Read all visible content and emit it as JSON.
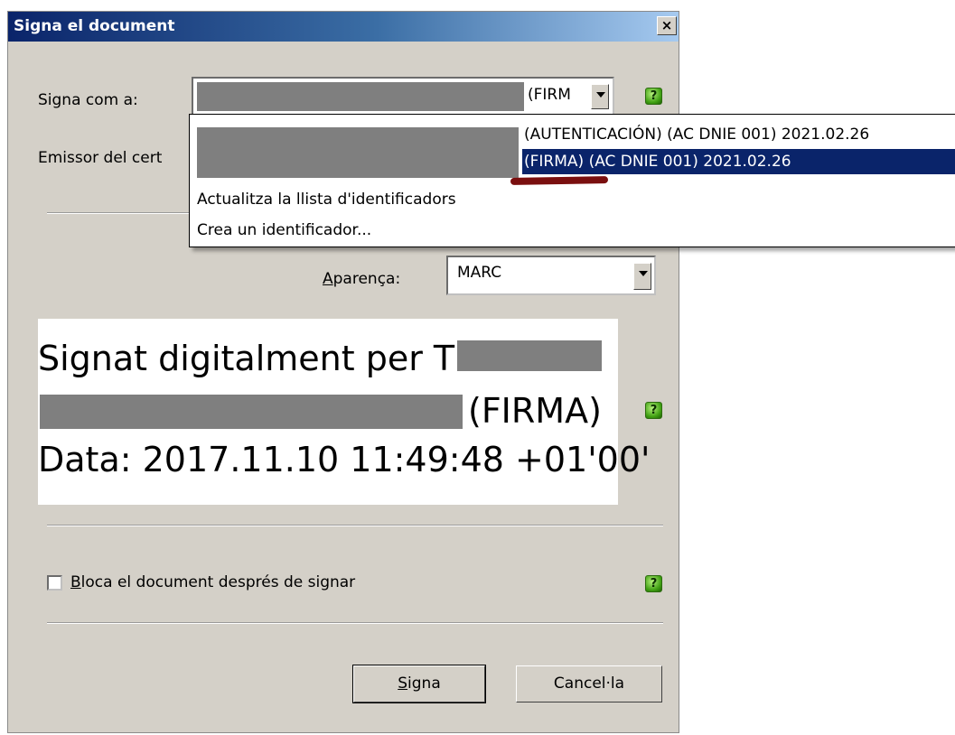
{
  "dialog": {
    "title": "Signa el document",
    "close_glyph": "×"
  },
  "sign_as": {
    "label": "Signa com a:",
    "combo_text": "(FIRM"
  },
  "issuer": {
    "label": "Emissor del cert"
  },
  "appearance": {
    "label_underline": "A",
    "label_rest": "parença:",
    "value": "MARC"
  },
  "preview": {
    "line1": "Signat digitalment per T",
    "line2": "(FIRMA)",
    "line3": "Data: 2017.11.10 11:49:48 +01'00'"
  },
  "lock": {
    "label_underline": "B",
    "label_rest": "loca el document després de signar"
  },
  "buttons": {
    "sign_underline": "S",
    "sign_rest": "igna",
    "cancel": "Cancel·la"
  },
  "dropdown": {
    "options": [
      "(AUTENTICACIÓN) (AC DNIE 001) 2021.02.26",
      "(FIRMA) (AC DNIE 001) 2021.02.26",
      "Actualitza la llista d'identificadors",
      "Crea un identificador..."
    ],
    "selected_index": 1
  },
  "icons": {
    "help": "?"
  },
  "colors": {
    "title_gradient_start": "#0a246a",
    "selection": "#0a246a",
    "dialog_bg": "#d4d0c8",
    "annotation_mark": "#7a0f0f"
  }
}
